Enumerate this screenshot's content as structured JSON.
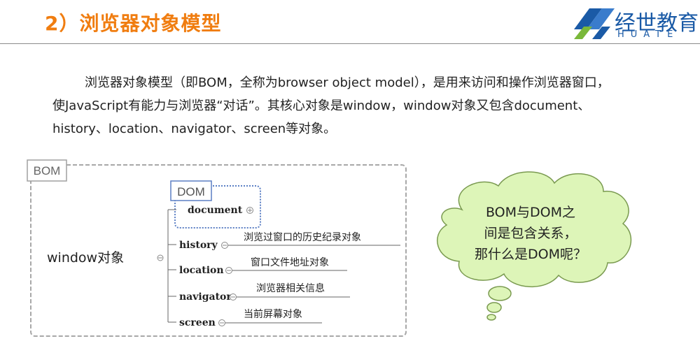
{
  "header": {
    "title": "2）浏览器对象模型",
    "logo_cn": "经世教育",
    "logo_en": "HUATE"
  },
  "paragraph": {
    "line1": "浏览器对象模型（即BOM，全称为browser object model），是用来访问和操作浏览器窗口，",
    "line2": "使JavaScript有能力与浏览器“对话”。其核心对象是window，window对象又包含document、",
    "line3": "history、location、navigator、screen等对象。"
  },
  "diagram": {
    "bom_label": "BOM",
    "dom_label": "DOM",
    "root": "window对象",
    "children": [
      {
        "name": "document",
        "desc": ""
      },
      {
        "name": "history",
        "desc": "浏览过窗口的历史纪录对象"
      },
      {
        "name": "location",
        "desc": "窗口文件地址对象"
      },
      {
        "name": "navigator",
        "desc": "浏览器相关信息"
      },
      {
        "name": "screen",
        "desc": "当前屏幕对象"
      }
    ]
  },
  "bubble": {
    "line1": "BOM与DOM之",
    "line2": "间是包含关系，",
    "line3": "那什么是DOM呢？"
  },
  "colors": {
    "title": "#f07d10",
    "logo": "#1a5aa6",
    "logo_green": "#7ab83a",
    "dom_border": "#5b7fc4",
    "bubble_fill": "#ddf5b8",
    "bubble_stroke": "#7a9a50"
  }
}
